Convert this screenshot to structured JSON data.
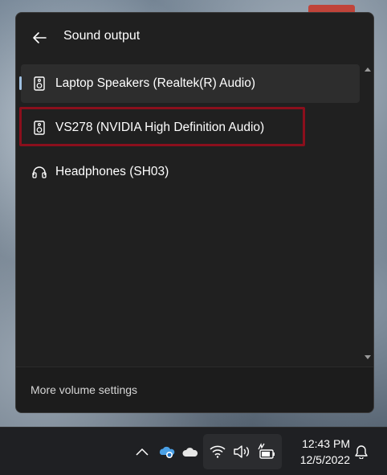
{
  "panel": {
    "title": "Sound output",
    "back_icon": "arrow-left-icon",
    "devices": [
      {
        "label": "Laptop Speakers (Realtek(R) Audio)",
        "icon": "speaker-icon",
        "selected": true
      },
      {
        "label": "VS278 (NVIDIA High Definition Audio)",
        "icon": "speaker-icon",
        "selected": false,
        "highlighted": true
      },
      {
        "label": "Headphones (SH03)",
        "icon": "headphones-icon",
        "selected": false
      }
    ],
    "footer_link": "More volume settings"
  },
  "taskbar": {
    "time": "12:43 PM",
    "date": "12/5/2022",
    "icons": [
      "chevron-up-icon",
      "onedrive-icon",
      "cloud-icon",
      "wifi-icon",
      "volume-icon",
      "battery-icon",
      "notification-icon"
    ]
  },
  "colors": {
    "panel_bg": "#202020",
    "selected_bg": "#2d2d2d",
    "accent_indicator": "#9fbfe0",
    "highlight_border": "#8b0f1c",
    "taskbar_bg": "#1f2023"
  }
}
